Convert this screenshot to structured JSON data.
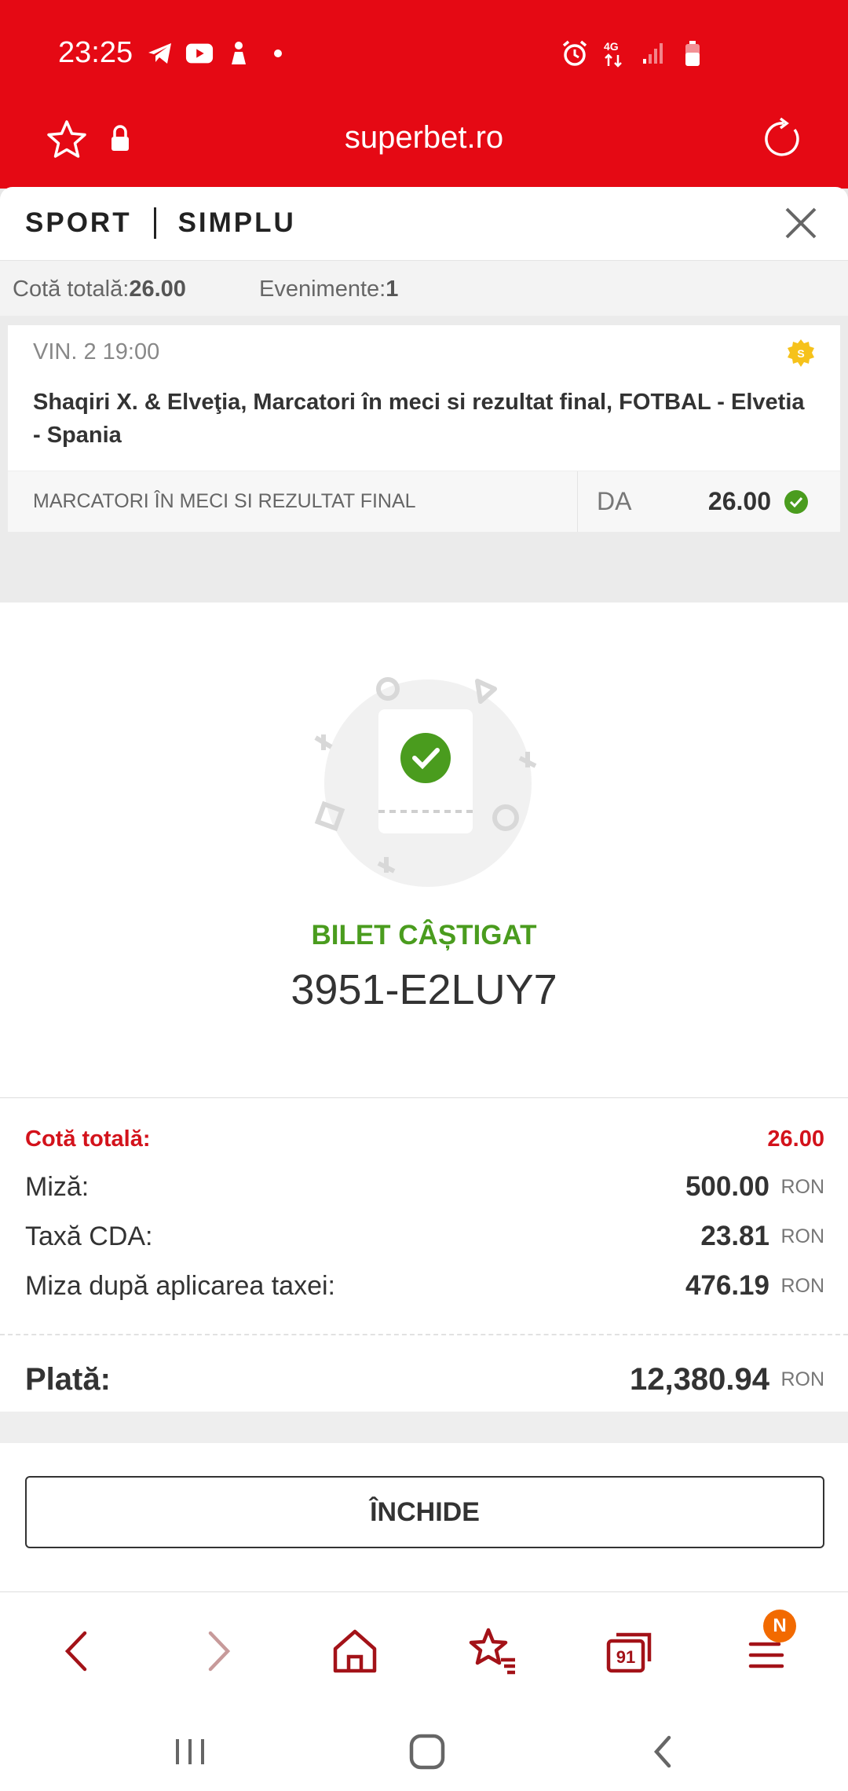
{
  "status": {
    "time": "23:25",
    "network": "4G"
  },
  "browser": {
    "url": "superbet.ro"
  },
  "sheet": {
    "sport": "SPORT",
    "bet_type": "SIMPLU",
    "summary_odds_label": "Cotă totală:",
    "summary_odds_value": "26.00",
    "summary_events_label": "Evenimente:",
    "summary_events_value": "1"
  },
  "event": {
    "date": "VIN. 2   19:00",
    "title": "Shaqiri X. & Elveţia, Marcatori în meci si rezultat final, FOTBAL - Elvetia - Spania",
    "market": "MARCATORI ÎN MECI SI REZULTAT FINAL",
    "pick": "DA",
    "odd": "26.00",
    "badge_letter": "S"
  },
  "result": {
    "status": "BILET CÂȘTIGAT",
    "ticket_code": "3951-E2LUY7"
  },
  "totals": {
    "total_odds_label": "Cotă totală:",
    "total_odds_value": "26.00",
    "stake_label": "Miză:",
    "stake_value": "500.00",
    "tax_label": "Taxă CDA:",
    "tax_value": "23.81",
    "net_stake_label": "Miza după aplicarea taxei:",
    "net_stake_value": "476.19",
    "payout_label": "Plată:",
    "payout_value": "12,380.94",
    "currency": "RON"
  },
  "close_button": "ÎNCHIDE",
  "bottom_bar": {
    "tabs_count": "91",
    "notification": "N"
  },
  "colors": {
    "brand_red": "#e50914",
    "win_green": "#4a9c1e",
    "odds_red": "#d3121b",
    "notif_orange": "#f26a00"
  }
}
